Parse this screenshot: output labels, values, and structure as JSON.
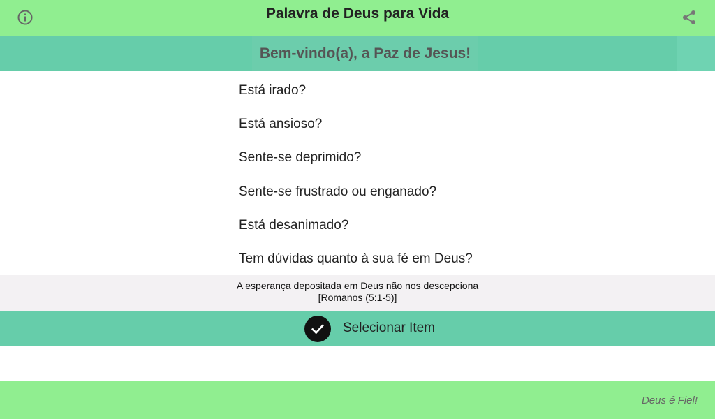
{
  "header": {
    "title": "Palavra de Deus para Vida",
    "left_icon": "info-icon",
    "right_icon": "share-icon"
  },
  "welcome": {
    "text": "Bem-vindo(a), a Paz de Jesus!"
  },
  "questions": [
    "Está irado?",
    "Está ansioso?",
    "Sente-se deprimido?",
    "Sente-se frustrado ou enganado?",
    "Está desanimado?",
    "Tem dúvidas quanto à sua fé em Deus?"
  ],
  "verse": {
    "text": "A esperança depositada em Deus não nos descepciona",
    "reference": "[Romanos (5:1-5)]"
  },
  "select": {
    "label": "Selecionar Item",
    "icon": "check-circle-icon"
  },
  "footer": {
    "text": "Deus é Fiel!"
  },
  "colors": {
    "bar_green": "#90ee90",
    "band_aqua": "#66cdaa",
    "verse_bg": "#f3f1f3"
  }
}
